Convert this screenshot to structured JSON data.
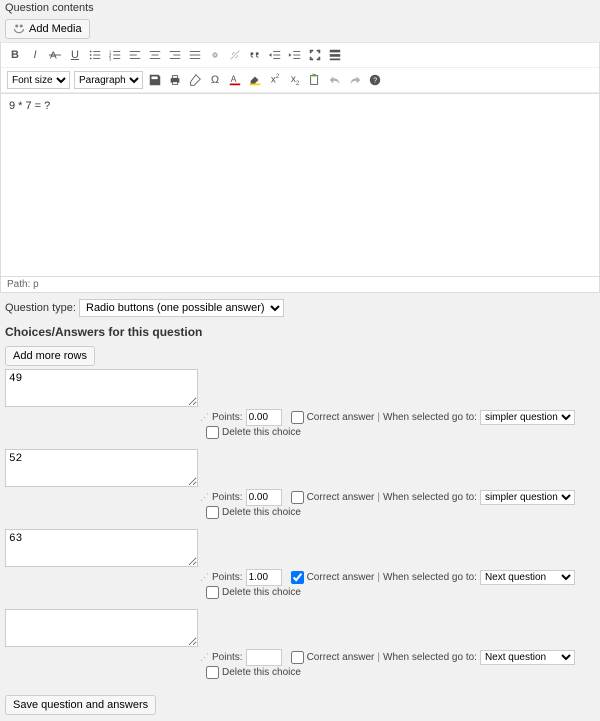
{
  "header_label": "Question contents",
  "add_media": "Add Media",
  "font_size_label": "Font size",
  "paragraph_label": "Paragraph",
  "editor_content": "9 * 7 = ?",
  "path_label": "Path: p",
  "qtype_label": "Question type:",
  "qtype_value": "Radio buttons (one possible answer)",
  "choices_heading": "Choices/Answers for this question",
  "add_rows": "Add more rows",
  "points_label": "Points:",
  "correct_label": "Correct answer",
  "goto_label": "When selected go to:",
  "delete_label": "Delete this choice",
  "rows": [
    {
      "text": "49",
      "points": "0.00",
      "correct": false,
      "goto": "simpler question"
    },
    {
      "text": "52",
      "points": "0.00",
      "correct": false,
      "goto": "simpler question"
    },
    {
      "text": "63",
      "points": "1.00",
      "correct": true,
      "goto": "Next question"
    },
    {
      "text": "",
      "points": "",
      "correct": false,
      "goto": "Next question"
    }
  ],
  "save_label": "Save question and answers"
}
